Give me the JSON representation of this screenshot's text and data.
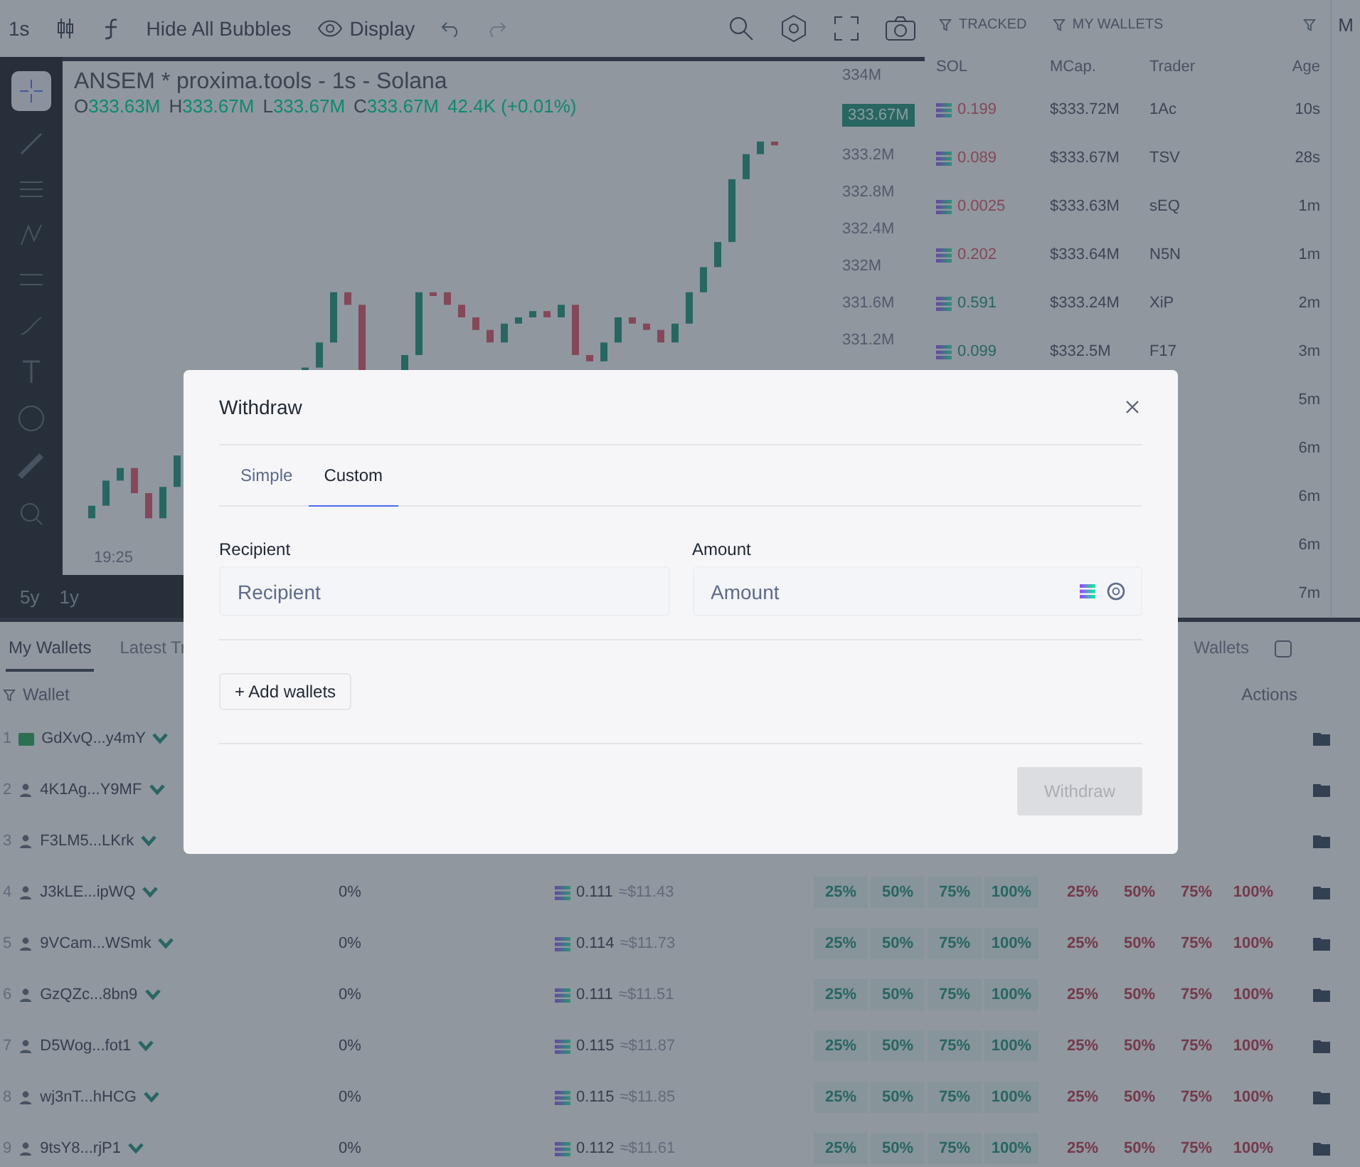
{
  "toolbar": {
    "interval": "1s",
    "bubbles_button": "Hide All Bubbles",
    "display_button": "Display"
  },
  "chart": {
    "title": "ANSEM * proxima.tools - 1s - Solana",
    "ohlc": [
      {
        "label": "O",
        "value": "333.63M"
      },
      {
        "label": "H",
        "value": "333.67M"
      },
      {
        "label": "L",
        "value": "333.67M"
      },
      {
        "label": "C",
        "value": "333.67M"
      }
    ],
    "change": "42.4K (+0.01%)",
    "price_axis": [
      "334M",
      "333.2M",
      "332.8M",
      "332.4M",
      "332M",
      "331.6M",
      "331.2M"
    ],
    "price_badge": "333.67M",
    "time_label": "19:25",
    "ranges": [
      "5y",
      "1y"
    ]
  },
  "trades": {
    "filters": [
      "TRACKED",
      "MY WALLETS"
    ],
    "columns": [
      "SOL",
      "MCap.",
      "Trader",
      "Age"
    ],
    "rows": [
      {
        "kind": "sell",
        "sol": "0.199",
        "mcap": "$333.72M",
        "trader": "1Ac",
        "age": "10s"
      },
      {
        "kind": "sell",
        "sol": "0.089",
        "mcap": "$333.67M",
        "trader": "TSV",
        "age": "28s"
      },
      {
        "kind": "sell",
        "sol": "0.0025",
        "mcap": "$333.63M",
        "trader": "sEQ",
        "age": "1m"
      },
      {
        "kind": "sell",
        "sol": "0.202",
        "mcap": "$333.64M",
        "trader": "N5N",
        "age": "1m"
      },
      {
        "kind": "buy",
        "sol": "0.591",
        "mcap": "$333.24M",
        "trader": "XiP",
        "age": "2m"
      },
      {
        "kind": "buy",
        "sol": "0.099",
        "mcap": "$332.5M",
        "trader": "F17",
        "age": "3m"
      },
      {
        "kind": "hidden",
        "age": "5m"
      },
      {
        "kind": "hidden",
        "age": "6m"
      },
      {
        "kind": "hidden",
        "age": "6m"
      },
      {
        "kind": "hidden",
        "age": "6m"
      },
      {
        "kind": "hidden",
        "age": "7m"
      }
    ]
  },
  "side_tab": "M",
  "wallets": {
    "tabs": [
      {
        "label": "My Wallets",
        "selected": true
      },
      {
        "label": "Latest Tr",
        "selected": false
      }
    ],
    "right_tab": "Wallets",
    "columns": {
      "wallet": "Wallet",
      "actions": "Actions"
    },
    "rows": [
      {
        "index": "1",
        "kind": "main",
        "wallet": "GdXvQ...y4mY"
      },
      {
        "index": "2",
        "kind": "user",
        "wallet": "4K1Ag...Y9MF"
      },
      {
        "index": "3",
        "kind": "user",
        "wallet": "F3LM5...LKrk"
      },
      {
        "index": "4",
        "kind": "user",
        "wallet": "J3kLE...ipWQ",
        "share": "0%",
        "sol": "0.111",
        "usd": "≈$11.43",
        "buy": [
          "25%",
          "50%",
          "75%",
          "100%"
        ],
        "sell": [
          "25%",
          "50%",
          "75%",
          "100%"
        ]
      },
      {
        "index": "5",
        "kind": "user",
        "wallet": "9VCam...WSmk",
        "share": "0%",
        "sol": "0.114",
        "usd": "≈$11.73",
        "buy": [
          "25%",
          "50%",
          "75%",
          "100%"
        ],
        "sell": [
          "25%",
          "50%",
          "75%",
          "100%"
        ]
      },
      {
        "index": "6",
        "kind": "user",
        "wallet": "GzQZc...8bn9",
        "share": "0%",
        "sol": "0.111",
        "usd": "≈$11.51",
        "buy": [
          "25%",
          "50%",
          "75%",
          "100%"
        ],
        "sell": [
          "25%",
          "50%",
          "75%",
          "100%"
        ]
      },
      {
        "index": "7",
        "kind": "user",
        "wallet": "D5Wog...fot1",
        "share": "0%",
        "sol": "0.115",
        "usd": "≈$11.87",
        "buy": [
          "25%",
          "50%",
          "75%",
          "100%"
        ],
        "sell": [
          "25%",
          "50%",
          "75%",
          "100%"
        ]
      },
      {
        "index": "8",
        "kind": "user",
        "wallet": "wj3nT...hHCG",
        "share": "0%",
        "sol": "0.115",
        "usd": "≈$11.85",
        "buy": [
          "25%",
          "50%",
          "75%",
          "100%"
        ],
        "sell": [
          "25%",
          "50%",
          "75%",
          "100%"
        ]
      },
      {
        "index": "9",
        "kind": "user",
        "wallet": "9tsY8...rjP1",
        "share": "0%",
        "sol": "0.112",
        "usd": "≈$11.61",
        "buy": [
          "25%",
          "50%",
          "75%",
          "100%"
        ],
        "sell": [
          "25%",
          "50%",
          "75%",
          "100%"
        ]
      }
    ]
  },
  "dialog": {
    "title": "Withdraw",
    "tabs": [
      {
        "label": "Simple",
        "selected": false
      },
      {
        "label": "Custom",
        "selected": true
      }
    ],
    "recipient": {
      "label": "Recipient",
      "placeholder": "Recipient"
    },
    "amount": {
      "label": "Amount",
      "placeholder": "Amount"
    },
    "add_button": "+ Add wallets",
    "submit": {
      "label": "Withdraw",
      "disabled": true
    }
  }
}
